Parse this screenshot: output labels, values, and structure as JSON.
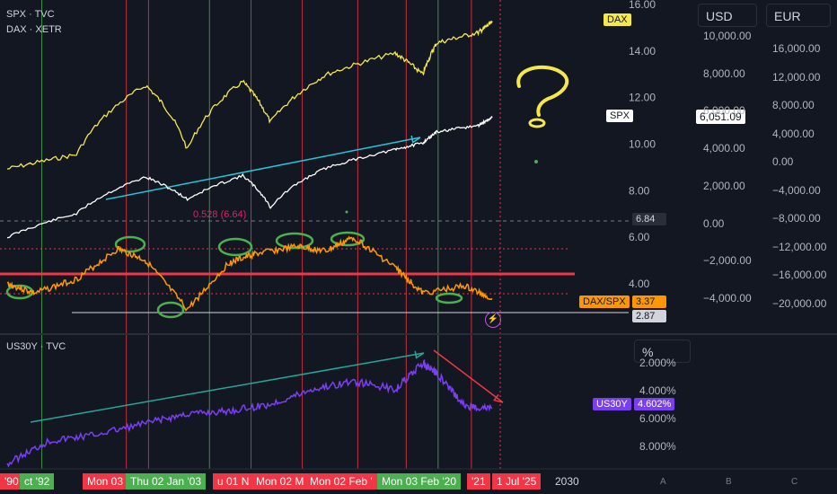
{
  "legends": {
    "spx": "SPX · TVC",
    "dax": "DAX · XETR",
    "us30y": "US30Y · TVC"
  },
  "header": {
    "usd_button": "USD",
    "eur_button": "EUR",
    "percent_button": "%"
  },
  "tags": {
    "dax": "DAX",
    "spx": "SPX",
    "spx_value": "6,051.09",
    "ratio_left": "6.84",
    "daxspx_label": "DAX/SPX",
    "daxspx_value": "3.37",
    "ratio_low": "2.87",
    "us30y_label": "US30Y",
    "us30y_value": "4.602%",
    "overlay": "0.528 (6.64)"
  },
  "axes": {
    "ratio_ticks": [
      "16.00",
      "14.00",
      "12.00",
      "10.00",
      "8.00",
      "6.00",
      "4.00"
    ],
    "usd_ticks": [
      "10,000.00",
      "8,000.00",
      "6,000.00",
      "4,000.00",
      "2,000.00",
      "0.00",
      "−2,000.00",
      "−4,000.00"
    ],
    "eur_ticks": [
      "16,000.00",
      "12,000.00",
      "8,000.00",
      "4,000.00",
      "0.00",
      "−4,000.00",
      "−8,000.00",
      "−12,000.00",
      "−16,000.00",
      "−20,000.00"
    ],
    "yield_ticks": [
      "2.000%",
      "4.000%",
      "6.000%",
      "8.000%"
    ],
    "time_labels": [
      "'90",
      "ct '92",
      "Mon 03",
      "Thu 02 Jan '03",
      "u 01 N",
      "Mon 02 M",
      "Mon 02 Feb '",
      "Mon 03 Feb '20",
      "'21",
      "1 Jul '25",
      "2030"
    ],
    "corner_letters": [
      "A",
      "B",
      "C"
    ]
  },
  "colors": {
    "dax": "#f5e94a",
    "spx": "#ffffff",
    "ratio": "#ff9800",
    "us30y": "#7b3ff2",
    "vline_red": "#f23645",
    "vline_green": "#4caf50",
    "arrow_cyan": "#26c6da",
    "arrow_teal": "#26a69a",
    "arrow_red": "#f23645",
    "horizontal_red": "#f23645"
  },
  "chart_data": [
    {
      "type": "line",
      "title": "",
      "series": [
        {
          "name": "SPX",
          "x": [
            1990,
            1995,
            2000,
            2003,
            2007,
            2009,
            2013,
            2018,
            2020,
            2021,
            2024,
            2025
          ],
          "values": [
            340,
            600,
            1450,
            850,
            1500,
            700,
            1800,
            2800,
            3300,
            4300,
            5000,
            6051
          ]
        },
        {
          "name": "DAX",
          "x": [
            1990,
            1995,
            2000,
            2003,
            2007,
            2009,
            2013,
            2018,
            2020,
            2021,
            2024,
            2025
          ],
          "values": [
            1800,
            2300,
            7500,
            2500,
            8000,
            4000,
            9000,
            13000,
            9000,
            15500,
            18500,
            22000
          ]
        },
        {
          "name": "DAX/SPX",
          "x": [
            1990,
            1992,
            1995,
            1998,
            2000,
            2003,
            2006,
            2008,
            2011,
            2013,
            2015,
            2018,
            2020,
            2023,
            2025
          ],
          "values": [
            4.0,
            3.6,
            4.2,
            5.5,
            5.0,
            2.9,
            4.9,
            5.3,
            5.6,
            5.4,
            6.0,
            4.7,
            3.6,
            3.9,
            3.37
          ]
        }
      ],
      "ylabel_left": "",
      "ylim_ratio": [
        2.5,
        16
      ]
    },
    {
      "type": "line",
      "title": "",
      "series": [
        {
          "name": "US30Y",
          "x": [
            1990,
            1993,
            1996,
            2000,
            2003,
            2006,
            2009,
            2012,
            2015,
            2018,
            2020,
            2021,
            2023,
            2025
          ],
          "values": [
            8.7,
            7.0,
            6.6,
            5.7,
            5.0,
            4.8,
            4.3,
            3.2,
            2.6,
            3.2,
            1.25,
            2.0,
            4.4,
            4.602
          ]
        }
      ],
      "ylim": [
        1,
        8.8
      ],
      "inverted": true
    }
  ]
}
